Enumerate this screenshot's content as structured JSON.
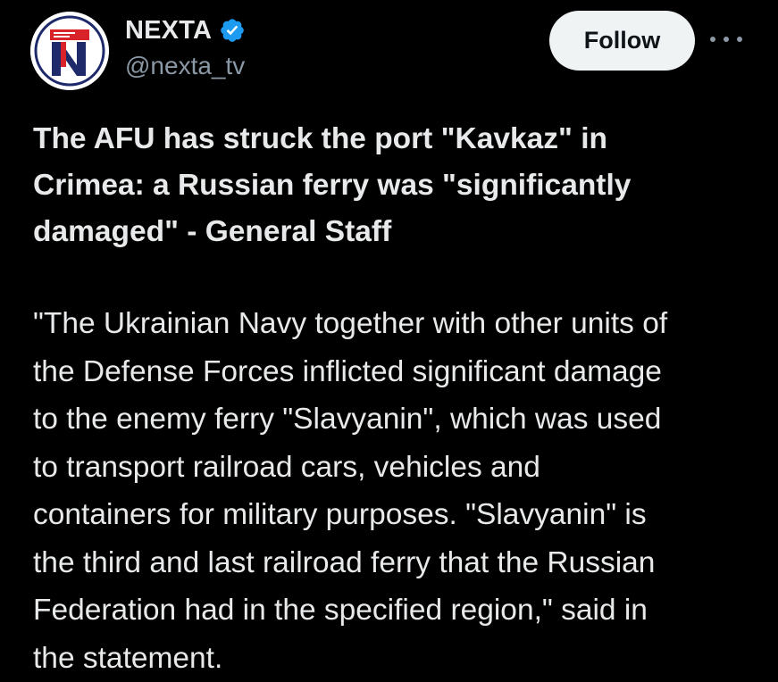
{
  "author": {
    "name": "NEXTA",
    "handle": "@nexta_tv",
    "verified": true,
    "avatar_icon": "nexta-logo-icon",
    "verified_icon": "verified-badge-icon"
  },
  "actions": {
    "follow_label": "Follow",
    "more_icon": "more-options-icon"
  },
  "post": {
    "title": "The AFU has struck the port \"Kavkaz\" in\nCrimea: a Russian ferry was \"significantly\ndamaged\" - General Staff",
    "body": "\"The Ukrainian Navy together with other units of\nthe Defense Forces inflicted significant damage\nto the enemy ferry \"Slavyanin\", which was used\nto transport railroad cars, vehicles and\ncontainers for military purposes. \"Slavyanin\" is\nthe third and last railroad ferry that the Russian\nFederation had in the specified region,\" said in\nthe statement."
  },
  "colors": {
    "background": "#000000",
    "text_primary": "#e7e9ea",
    "text_secondary": "#8b98a5",
    "verified_blue": "#1d9bf0",
    "follow_button_bg": "#eff3f4",
    "follow_button_text": "#0f1419",
    "logo_red": "#d8232a",
    "logo_navy": "#1f2a6b"
  }
}
